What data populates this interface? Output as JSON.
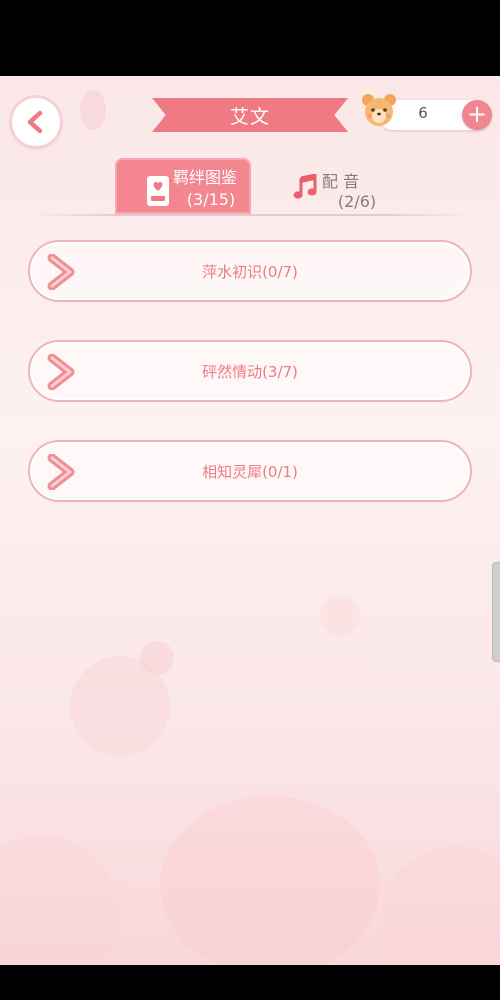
{
  "header": {
    "title": "艾文",
    "currency": {
      "value": "6",
      "avatar_icon": "bear-face-icon",
      "add_icon": "plus-icon"
    }
  },
  "tabs": [
    {
      "label": "羁绊图鉴",
      "count": "(3/15)",
      "icon": "card-heart-icon",
      "active": true
    },
    {
      "label": "配 音",
      "count": "(2/6)",
      "icon": "music-note-icon",
      "active": false
    }
  ],
  "chapters": [
    {
      "label": "萍水初识(0/7)"
    },
    {
      "label": "砰然情动(3/7)"
    },
    {
      "label": "相知灵犀(0/1)"
    }
  ],
  "colors": {
    "accent": "#f07a83",
    "text_pink": "#ec7b83",
    "background": "#fbe7e8"
  }
}
